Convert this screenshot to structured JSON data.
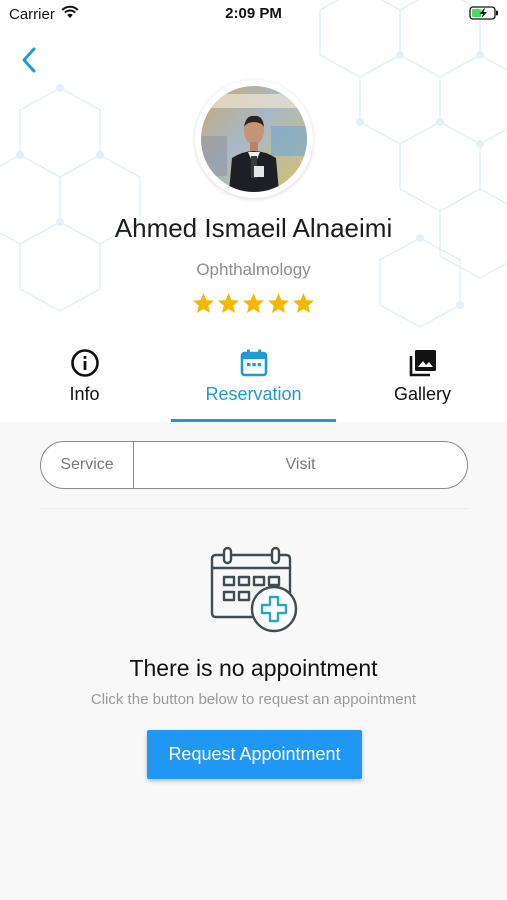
{
  "status_bar": {
    "carrier": "Carrier",
    "time": "2:09 PM",
    "battery_icon": "battery-charging-icon",
    "wifi_icon": "wifi-icon"
  },
  "header": {
    "back_icon": "chevron-left-icon"
  },
  "doctor": {
    "name": "Ahmed Ismaeil Alnaeimi",
    "specialty": "Ophthalmology",
    "rating": 5,
    "rating_max": 5
  },
  "tabs": [
    {
      "label": "Info",
      "icon": "info-icon",
      "active": false
    },
    {
      "label": "Reservation",
      "icon": "calendar-icon",
      "active": true
    },
    {
      "label": "Gallery",
      "icon": "gallery-icon",
      "active": false
    }
  ],
  "segment": {
    "service_label": "Service",
    "visit_label": "Visit"
  },
  "empty_state": {
    "icon": "calendar-add-icon",
    "title": "There is no appointment",
    "subtitle": "Click the button below to request an appointment",
    "button_label": "Request Appointment"
  },
  "colors": {
    "accent": "#1e9ad6",
    "button": "#2196f3",
    "star": "#f5b800"
  }
}
